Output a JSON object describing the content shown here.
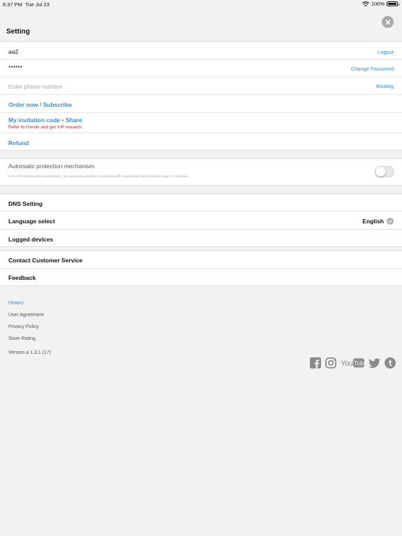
{
  "status_bar": {
    "time": "6:37 PM",
    "date": "Tue Jul 23",
    "battery": "100%"
  },
  "header": {
    "title": "Setting"
  },
  "account": {
    "username": "aa2",
    "logout_label": "Logout",
    "password_mask": "******",
    "change_password_label": "Change Password",
    "phone_placeholder": "Enter phone number",
    "binding_label": "Binding",
    "order_label": "Order now / Subscribe",
    "invitation_label": "My invitation code • Share",
    "invitation_hint": "Refer to friends and get VIP rewards",
    "refund_label": "Refund"
  },
  "protection": {
    "title": "Automatic protection mechanism",
    "description": "If the VPN disconnects unexpectedly , the automatic protection mechanism will immediately close all related pages or software.",
    "enabled": false
  },
  "settings": {
    "dns_label": "DNS Setting",
    "language_label": "Language select",
    "language_value": "English",
    "devices_label": "Logged devices"
  },
  "support": {
    "contact_label": "Contact Customer Service",
    "feedback_label": "Feedback"
  },
  "footer": {
    "history": "History",
    "user_agreement": "User Agreement",
    "privacy_policy": "Privacy Policy",
    "store_rating": "Store Rating",
    "version": "Version a 1.3.1 (17)"
  },
  "colors": {
    "accent": "#3b8ed8",
    "warning": "#c62828",
    "icon_gray": "#8a8a8a"
  },
  "social_icons": [
    "facebook-icon",
    "instagram-icon",
    "youtube-icon",
    "twitter-icon",
    "tumblr-icon"
  ]
}
